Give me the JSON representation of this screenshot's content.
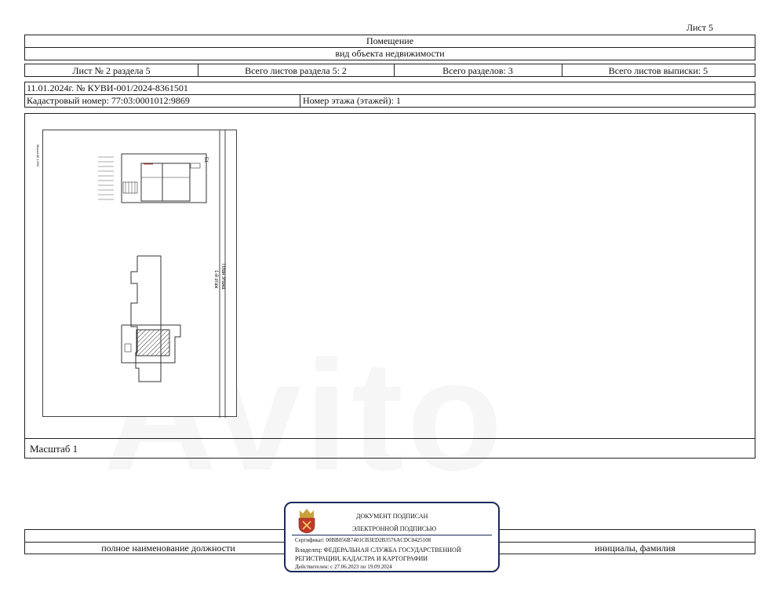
{
  "sheet_label": "Лист 5",
  "header": {
    "title": "Помещение",
    "subtitle": "вид объекта недвижимости"
  },
  "info_row": {
    "sheet_in_section": "Лист № 2 раздела 5",
    "total_sheets_section": "Всего листов раздела 5: 2",
    "total_sections": "Всего разделов: 3",
    "total_sheets_extract": "Всего листов выписки: 5"
  },
  "doc_ref": "11.01.2024г. № КУВИ-001/2024-8361501",
  "cadastral_number": "Кадастровый номер: 77:03:0001012:9869",
  "floor_number": "Номер этажа (этажей): 1",
  "plan": {
    "scale_caption": "Масштаб 1:500",
    "floor_caption": "План этажа",
    "floor_label": "1-й этаж",
    "marker": "Б1"
  },
  "scale": "Масштаб 1",
  "signature": {
    "position_label": "полное наименование должности",
    "initials_label": "инициалы, фамилия"
  },
  "stamp": {
    "line1": "ДОКУМЕНТ ПОДПИСАН",
    "line2": "ЭЛЕКТРОННОЙ ПОДПИСЬЮ",
    "certificate": "Сертификат: 00BB056B7401CB3ED2B3576ACDC8425108",
    "owner1": "Владелец: ФЕДЕРАЛЬНАЯ СЛУЖБА ГОСУДАРСТВЕННОЙ",
    "owner2": "РЕГИСТРАЦИИ, КАДАСТРА И КАРТОГРАФИИ",
    "validity": "Действителен: с 27.06.2023 по 19.09.2024"
  },
  "watermark": "Avito"
}
